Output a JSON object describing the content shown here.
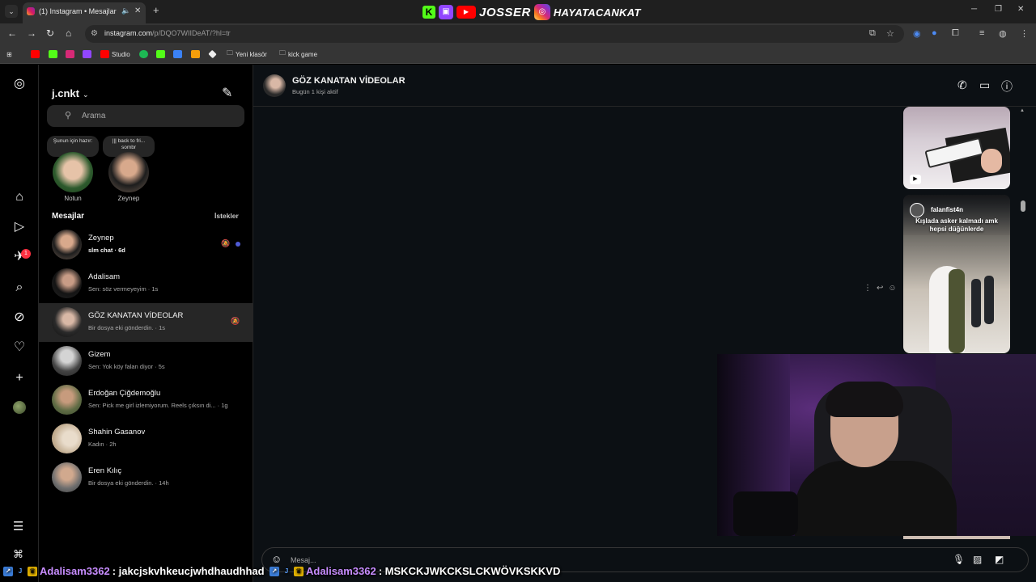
{
  "browser": {
    "tab_title": "(1) Instagram • Mesajlar",
    "url_host": "instagram.com",
    "url_path": "/p/DQO7WIIDeAT/?hl=tr",
    "bookmarks": [
      "Studio",
      "Yeni klasör",
      "kick game"
    ]
  },
  "overlay": {
    "name": "JOSSER",
    "handle": "HAYATACANKAT"
  },
  "inbox": {
    "username": "j.cnkt",
    "search_placeholder": "Arama",
    "notes": [
      {
        "bubble": "Şunun için hazır:",
        "name": "Notun"
      },
      {
        "bubble": "||| back to fri... sombr",
        "name": "Zeynep"
      }
    ],
    "section_title": "Mesajlar",
    "requests_label": "İstekler",
    "conversations": [
      {
        "name": "Zeynep",
        "preview": "slm chat · 6d"
      },
      {
        "name": "Adalisam",
        "preview": "Sen: söz vermeyeyim · 1s"
      },
      {
        "name": "GÖZ KANATAN VİDEOLAR",
        "preview": "Bir dosya eki gönderdin. · 1s"
      },
      {
        "name": "Gizem",
        "preview": "Sen: Yok köy falan diyor · 5s"
      },
      {
        "name": "Erdoğan Çiğdemoğlu",
        "preview": "Sen: Pick me girl izlemiyorum. Reels çıksın di... · 1g"
      },
      {
        "name": "Shahin Gasanov",
        "preview": "Kadın · 2h"
      },
      {
        "name": "Eren Kılıç",
        "preview": "Bir dosya eki gönderdin. · 14h"
      }
    ]
  },
  "rail": {
    "notification_count": "1"
  },
  "chat": {
    "title": "GÖZ KANATAN VİDEOLAR",
    "subtitle": "Bugün 1 kişi aktif",
    "reel_user": "falanfist4n",
    "reel_caption": "Kışlada asker kalmadı amk hepsi düğünlerde",
    "composer_placeholder": "Mesaj..."
  },
  "ticker": [
    {
      "user": "Adalisam3362",
      "message": ": jakcjskvhkeucjwhdhaudhhad"
    },
    {
      "user": "Adalisam3362",
      "message": ": MSKCKJWKCKSLCKWÖVKSKKVD"
    }
  ],
  "colors": {
    "accent_unread_dot": "#4f5bd5",
    "badge_red": "#ff3040",
    "ticker_user": "#c88dff"
  }
}
